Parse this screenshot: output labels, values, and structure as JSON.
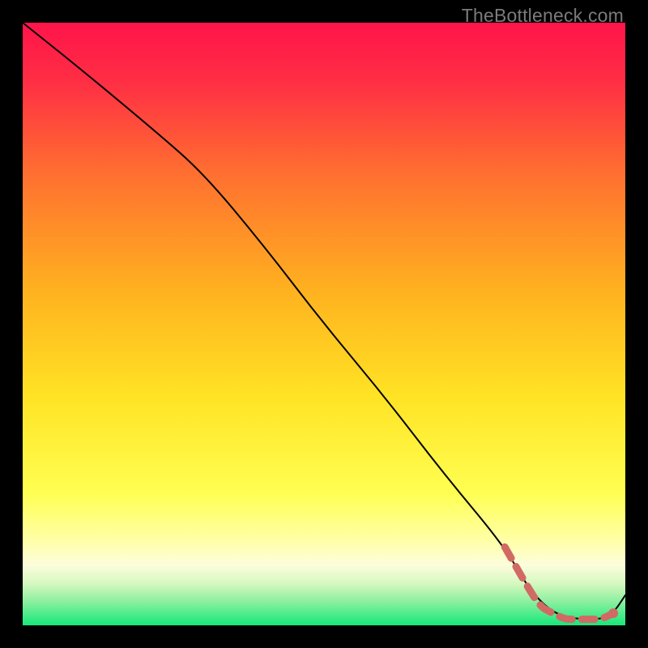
{
  "watermark": "TheBottleneck.com",
  "colors": {
    "bg": "#000000",
    "gradient_top": "#ff1a4b",
    "gradient_mid_upper": "#ff7a2c",
    "gradient_mid": "#ffd21e",
    "gradient_lower": "#ffff70",
    "gradient_pale": "#fdfec1",
    "gradient_bottom": "#17e87a",
    "line_main": "#000000",
    "line_overlay": "#d16a64",
    "overlay_dot": "#d16a64"
  },
  "chart_data": {
    "type": "line",
    "title": "",
    "xlabel": "",
    "ylabel": "",
    "xlim": [
      0,
      100
    ],
    "ylim": [
      0,
      100
    ],
    "series": [
      {
        "name": "main-curve",
        "x": [
          0,
          10,
          22,
          30,
          40,
          50,
          60,
          70,
          80,
          84,
          88,
          92,
          96,
          98,
          100
        ],
        "y": [
          100,
          92,
          82,
          75,
          63,
          50,
          38,
          25,
          13,
          6,
          2,
          1,
          1,
          2,
          5
        ]
      },
      {
        "name": "overlay-segment",
        "style": "thick-dashed",
        "x": [
          80,
          84,
          86,
          88,
          90,
          92,
          94,
          96,
          98
        ],
        "y": [
          13,
          6,
          3,
          2,
          1,
          1,
          1,
          1,
          2
        ]
      }
    ],
    "points": [
      {
        "name": "overlay-end-dot",
        "x": 98,
        "y": 2
      }
    ]
  }
}
